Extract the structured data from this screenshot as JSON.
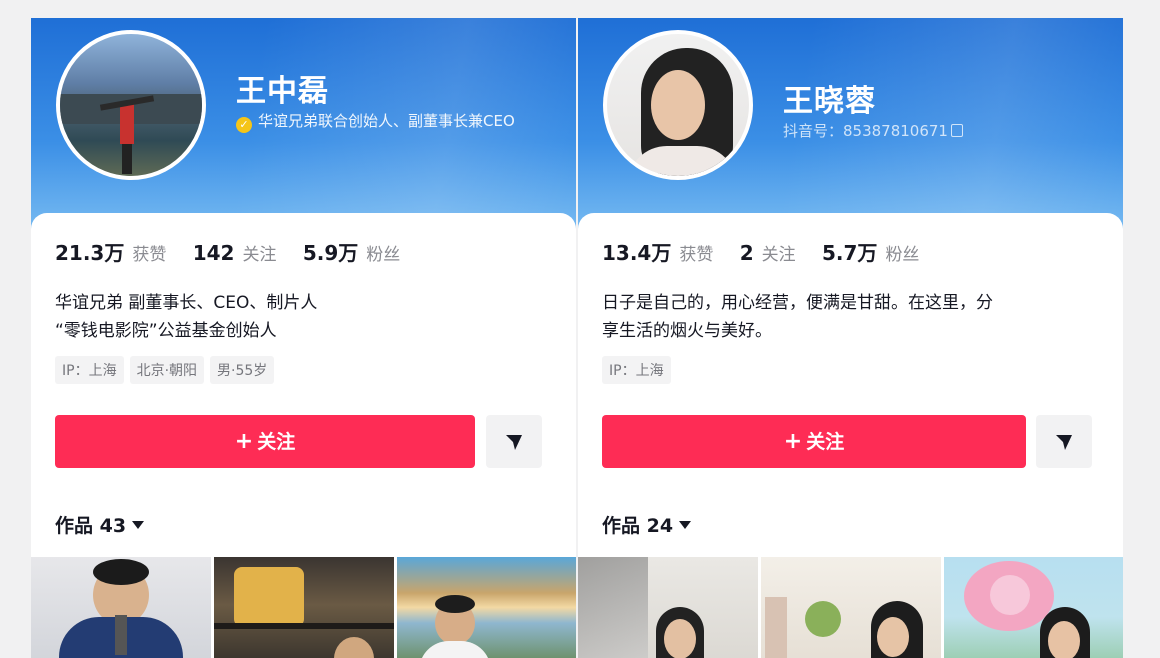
{
  "profiles": [
    {
      "name": "王中磊",
      "verify_text": "华谊兄弟联合创始人、副董事长兼CEO",
      "stats": [
        {
          "value": "21.3万",
          "label": "获赞"
        },
        {
          "value": "142",
          "label": "关注"
        },
        {
          "value": "5.9万",
          "label": "粉丝"
        }
      ],
      "bio_lines": [
        "华谊兄弟 副董事长、CEO、制片人",
        "“零钱电影院”公益基金创始人"
      ],
      "tags": [
        "IP：上海",
        "北京·朝阳",
        "男·55岁"
      ],
      "follow_label": "关注",
      "works_label": "作品 43"
    },
    {
      "name": "王晓蓉",
      "douyin_id": "抖音号：85387810671",
      "stats": [
        {
          "value": "13.4万",
          "label": "获赞"
        },
        {
          "value": "2",
          "label": "关注"
        },
        {
          "value": "5.7万",
          "label": "粉丝"
        }
      ],
      "bio_lines": [
        "日子是自己的，用心经营，便满是甘甜。在这里，分",
        "享生活的烟火与美好。"
      ],
      "tags": [
        "IP：上海"
      ],
      "follow_label": "关注",
      "works_label": "作品 24"
    }
  ],
  "icons": {
    "verified": "verified-badge-icon",
    "copy": "copy-icon",
    "share": "share-icon",
    "plus": "plus-icon",
    "caret": "caret-down-icon"
  },
  "colors": {
    "follow": "#fe2c55",
    "header": "#2f7fe0",
    "verified": "#f5c518"
  }
}
